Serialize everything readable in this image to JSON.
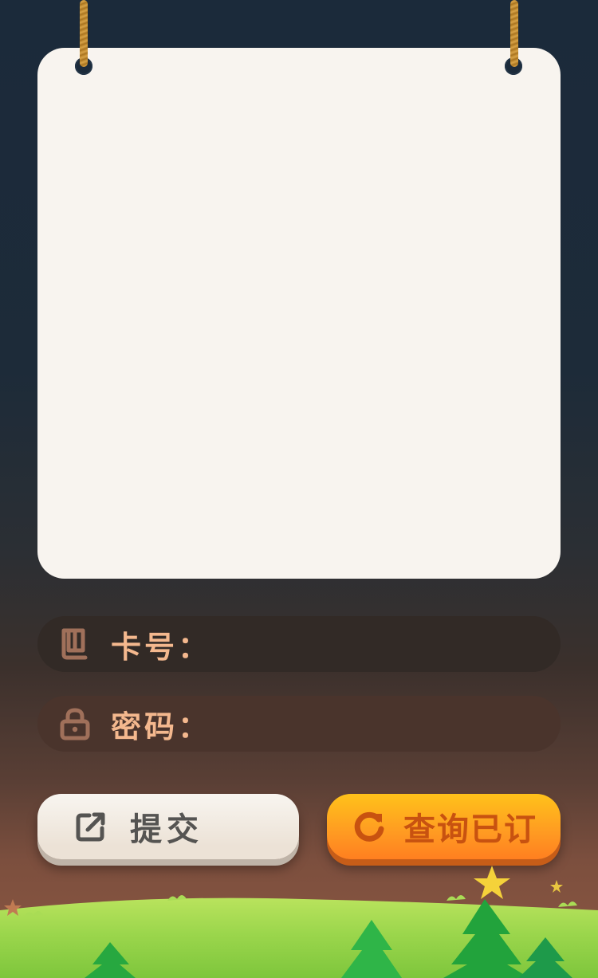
{
  "form": {
    "card_label": "卡号：",
    "card_value": "",
    "password_label": "密码：",
    "password_value": ""
  },
  "buttons": {
    "submit_label": "提交",
    "query_label": "查询已订"
  },
  "icons": {
    "card": "book-icon",
    "password": "lock-icon",
    "submit": "external-link-icon",
    "query": "refresh-icon"
  },
  "colors": {
    "label": "#f4b88e",
    "query_button": "#ff9a22",
    "submit_button": "#f0e8de",
    "grass": "#8fd24a"
  }
}
